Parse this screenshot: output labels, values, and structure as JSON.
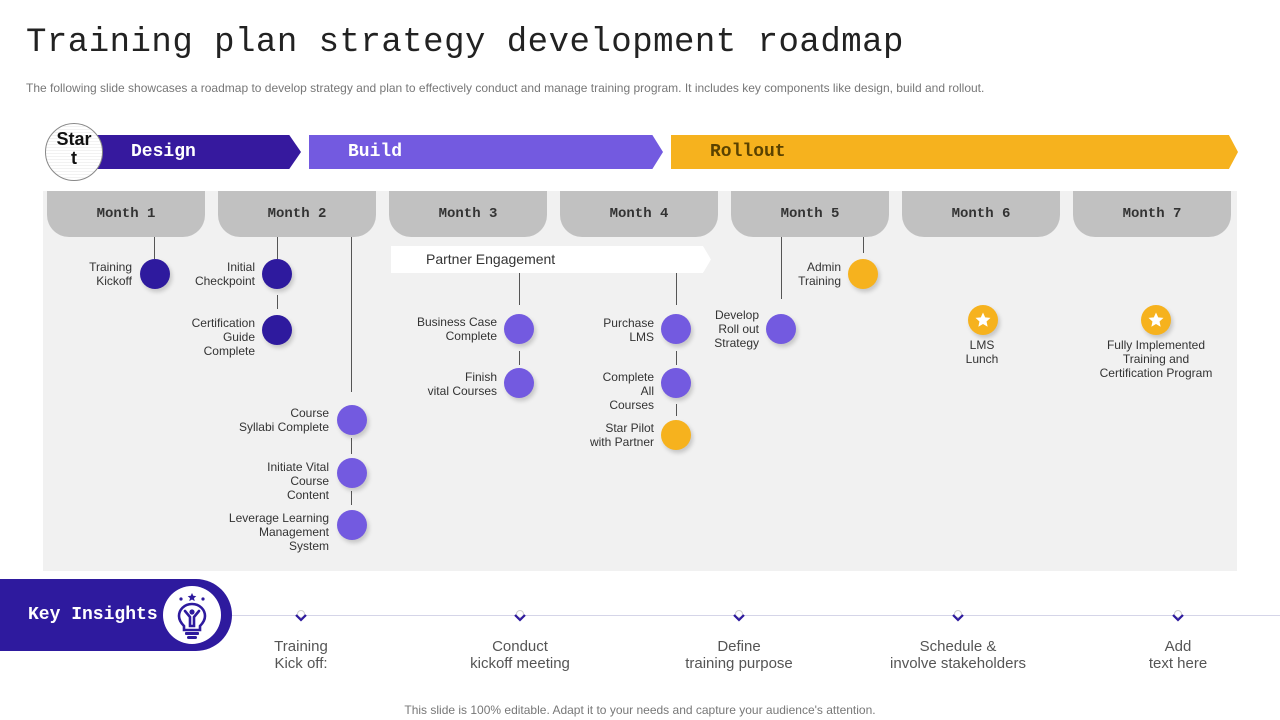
{
  "title": "Training plan strategy development roadmap",
  "subtitle": "The following slide showcases a roadmap to develop strategy and plan to effectively conduct and manage training program. It includes key components like design, build and rollout.",
  "start_label": "Star\nt",
  "phases": [
    {
      "label": "Design",
      "color": "#36199e"
    },
    {
      "label": "Build",
      "color": "#735ae0"
    },
    {
      "label": "Rollout",
      "color": "#f6b21e"
    }
  ],
  "months": [
    "Month 1",
    "Month 2",
    "Month 3",
    "Month 4",
    "Month 5",
    "Month 6",
    "Month 7"
  ],
  "partner_engagement": "Partner Engagement",
  "milestones": {
    "training_kickoff": "Training\nKickoff",
    "initial_checkpoint": "Initial\nCheckpoint",
    "certification_guide": "Certification\nGuide\nComplete",
    "course_syllabi": "Course\nSyllabi Complete",
    "initiate_vital": "Initiate Vital\nCourse\nContent",
    "leverage_lms": "Leverage Learning\nManagement\nSystem",
    "business_case": "Business Case\nComplete",
    "finish_vital": "Finish\nvital Courses",
    "purchase_lms": "Purchase\nLMS",
    "complete_all": "Complete\nAll\nCourses",
    "star_pilot": "Star Pilot\nwith Partner",
    "develop_rollout": "Develop\nRoll out\nStrategy",
    "admin_training": "Admin\nTraining",
    "lms_lunch": "LMS\nLunch",
    "fully_implemented": "Fully Implemented\nTraining and\nCertification Program"
  },
  "colors": {
    "dark_purple": "#2e1a9e",
    "purple": "#735ae0",
    "gold": "#f6b21e",
    "month_tab": "#c1c1c1",
    "board": "#f1f1f1"
  },
  "key_insights": {
    "label": "Key Insights",
    "icon": "lightbulb-person-icon",
    "items": [
      "Training\nKick off:",
      "Conduct\nkickoff meeting",
      "Define\ntraining purpose",
      "Schedule &\ninvolve stakeholders",
      "Add\ntext here"
    ]
  },
  "footer": "This slide is 100% editable. Adapt it to your needs and capture your audience's attention."
}
